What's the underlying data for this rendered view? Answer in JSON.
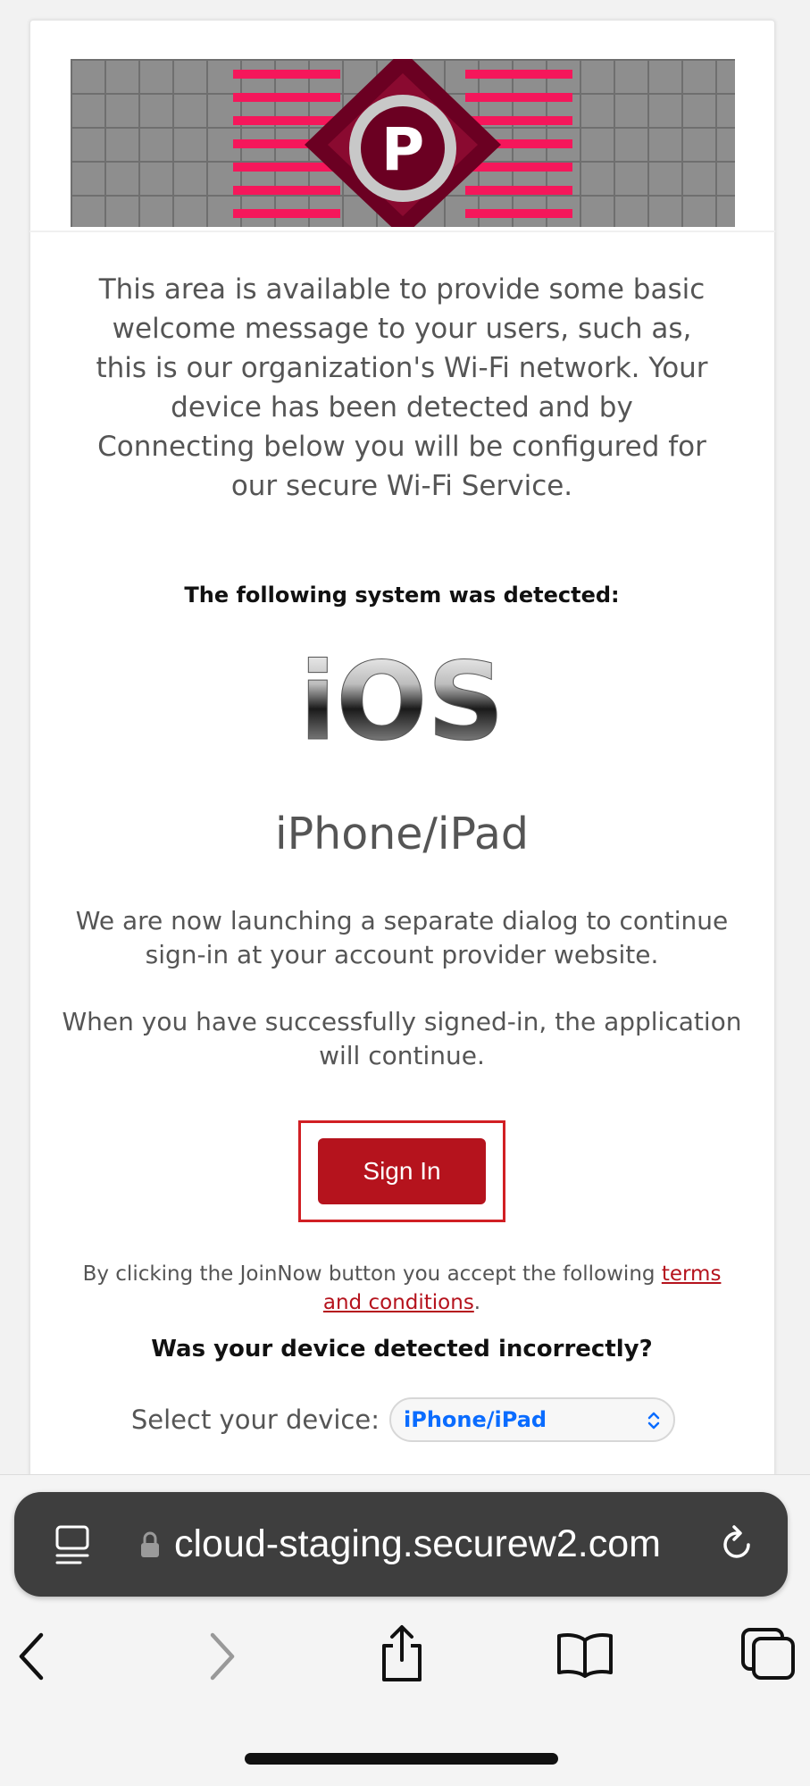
{
  "logo": {
    "letter": "P"
  },
  "welcome_text": "This area is available to provide some basic welcome message to your users, such as, this is our organization's Wi-Fi network. Your device has been detected and by Connecting below you will be configured for our secure Wi-Fi Service.",
  "detected_heading": "The following system was detected:",
  "os_logo_text": "iOS",
  "device_name": "iPhone/iPad",
  "launching_text": "We are now launching a separate dialog to continue sign-in at your account provider website.",
  "success_text": "When you have successfully signed-in, the application will continue.",
  "signin_label": "Sign In",
  "terms": {
    "prefix": "By clicking the JoinNow button you accept the following ",
    "link": "terms and conditions",
    "suffix": "."
  },
  "incorrect_heading": "Was your device detected incorrectly?",
  "select_label": "Select your device:",
  "selected_device": "iPhone/iPad",
  "browser": {
    "url": "cloud-staging.securew2.com",
    "icons": [
      "reader-icon",
      "lock-icon",
      "reload-icon",
      "back-icon",
      "forward-icon",
      "share-icon",
      "bookmarks-icon",
      "tabs-icon"
    ]
  },
  "colors": {
    "brand_red": "#b5131d",
    "highlight_red": "#d11f24",
    "select_blue": "#0a6cff",
    "logo_pink": "#f5175b",
    "logo_maroon": "#6b0022"
  }
}
